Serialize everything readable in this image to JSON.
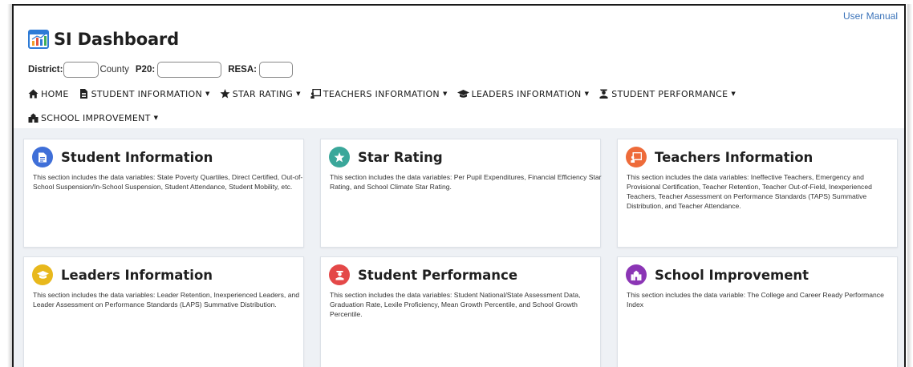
{
  "header": {
    "user_manual": "User Manual",
    "title": "SI Dashboard",
    "filters": {
      "district_label": "District:",
      "county_text": "County",
      "p20_label": "P20:",
      "resa_label": "RESA:"
    }
  },
  "nav": {
    "items": [
      {
        "label": "HOME",
        "icon": "home-icon",
        "dropdown": false
      },
      {
        "label": "STUDENT INFORMATION",
        "icon": "document-icon",
        "dropdown": true
      },
      {
        "label": "STAR RATING",
        "icon": "star-icon",
        "dropdown": true
      },
      {
        "label": "TEACHERS INFORMATION",
        "icon": "chalkboard-teacher-icon",
        "dropdown": true
      },
      {
        "label": "LEADERS INFORMATION",
        "icon": "graduation-cap-icon",
        "dropdown": true
      },
      {
        "label": "STUDENT PERFORMANCE",
        "icon": "user-graduate-icon",
        "dropdown": true
      },
      {
        "label": "SCHOOL IMPROVEMENT",
        "icon": "school-icon",
        "dropdown": true
      }
    ],
    "caret": "▼"
  },
  "cards": [
    {
      "title": "Student Information",
      "color": "#3f6fd8",
      "icon": "document-icon",
      "description": "This section includes the data variables: State Poverty Quartiles, Direct Certified, Out-of-School Suspension/In-School Suspension, Student Attendance, Student Mobility, etc."
    },
    {
      "title": "Star Rating",
      "color": "#3aa79a",
      "icon": "star-icon",
      "description": "This section includes the data variables: Per Pupil Expenditures, Financial Efficiency Star Rating, and School Climate Star Rating."
    },
    {
      "title": "Teachers Information",
      "color": "#ee6b3a",
      "icon": "chalkboard-teacher-icon",
      "description": "This section includes the data variables: Ineffective Teachers, Emergency and Provisional Certification, Teacher Retention, Teacher Out-of-Field, Inexperienced Teachers, Teacher Assessment on Performance Standards (TAPS) Summative Distribution, and Teacher Attendance."
    },
    {
      "title": "Leaders Information",
      "color": "#e8b81c",
      "icon": "graduation-cap-icon",
      "description": "This section includes the data variables: Leader Retention, Inexperienced Leaders, and Leader Assessment on Performance Standards (LAPS) Summative Distribution."
    },
    {
      "title": "Student Performance",
      "color": "#e44848",
      "icon": "user-graduate-icon",
      "description": "This section includes the data variables: Student National/State Assessment Data, Graduation Rate, Lexile Proficiency, Mean Growth Percentile, and School Growth Percentile."
    },
    {
      "title": "School Improvement",
      "color": "#8b35b5",
      "icon": "school-icon",
      "description": "This section includes the data variable: The College and Career Ready Performance Index"
    }
  ]
}
